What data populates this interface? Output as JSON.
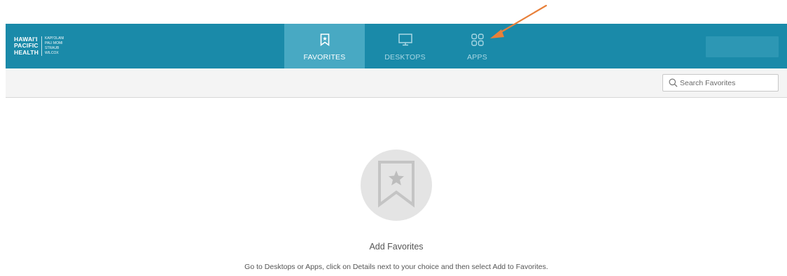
{
  "brand": {
    "main_lines": [
      "HAWAI'I",
      "PACIFIC",
      "HEALTH"
    ],
    "sub_lines": [
      "KAPI'OLANI",
      "PALI MOMI",
      "STRAUB",
      "WILCOX"
    ]
  },
  "nav": {
    "tabs": [
      {
        "label": "FAVORITES",
        "icon": "bookmark-icon",
        "active": true
      },
      {
        "label": "DESKTOPS",
        "icon": "monitor-icon",
        "active": false
      },
      {
        "label": "APPS",
        "icon": "apps-grid-icon",
        "active": false
      }
    ]
  },
  "toolbar": {
    "search_placeholder": "Search Favorites"
  },
  "empty_state": {
    "icon": "bookmark-star-icon",
    "title": "Add Favorites",
    "description": "Go to Desktops or Apps, click on Details next to your choice and then select Add to Favorites."
  },
  "annotation": {
    "icon": "arrow-pointer-icon",
    "target": "APPS",
    "color": "#e8803a"
  },
  "colors": {
    "header_bg": "#1a8aa9",
    "active_tab_bg": "#48a9c3",
    "inactive_tab_text": "#a9d7e4",
    "toolbar_bg": "#f4f4f4"
  }
}
